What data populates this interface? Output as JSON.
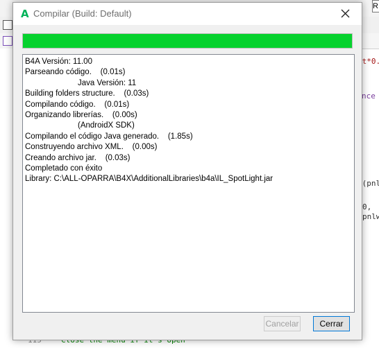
{
  "dialog": {
    "title": "Compilar (Build: Default)",
    "progress_fraction": 1.0,
    "progress_color": "#06d22e",
    "log_lines": [
      {
        "text": "B4A Versión: 11.00",
        "indent": false
      },
      {
        "text": "Parseando código.    (0.01s)",
        "indent": false
      },
      {
        "text": "Java Versión: 11",
        "indent": true
      },
      {
        "text": "Building folders structure.    (0.03s)",
        "indent": false
      },
      {
        "text": "Compilando código.    (0.01s)",
        "indent": false
      },
      {
        "text": "Organizando librerías.    (0.00s)",
        "indent": false
      },
      {
        "text": "(AndroidX SDK)",
        "indent": true
      },
      {
        "text": "Compilando el código Java generado.    (1.85s)",
        "indent": false
      },
      {
        "text": "Construyendo archivo XML.    (0.00s)",
        "indent": false
      },
      {
        "text": "Creando archivo jar.    (0.03s)",
        "indent": false
      },
      {
        "text": "Completado con éxito",
        "indent": false
      },
      {
        "text": "Library: C:\\ALL-OPARRA\\B4X\\AdditionalLibraries\\b4a\\IL_SpotLight.jar",
        "indent": false
      }
    ],
    "buttons": {
      "cancel": "Cancelar",
      "close": "Cerrar"
    }
  },
  "background": {
    "top_right_button": "R",
    "code_fragments": {
      "line_a": "nt*0.",
      "line_b": "nce",
      "line_c": "-(pnl",
      "line_d": "0, ",
      "line_e": "pnlw",
      "line_f": "Close the menu if it's open",
      "line_num_1": "115",
      "line_num_2": "116"
    }
  }
}
